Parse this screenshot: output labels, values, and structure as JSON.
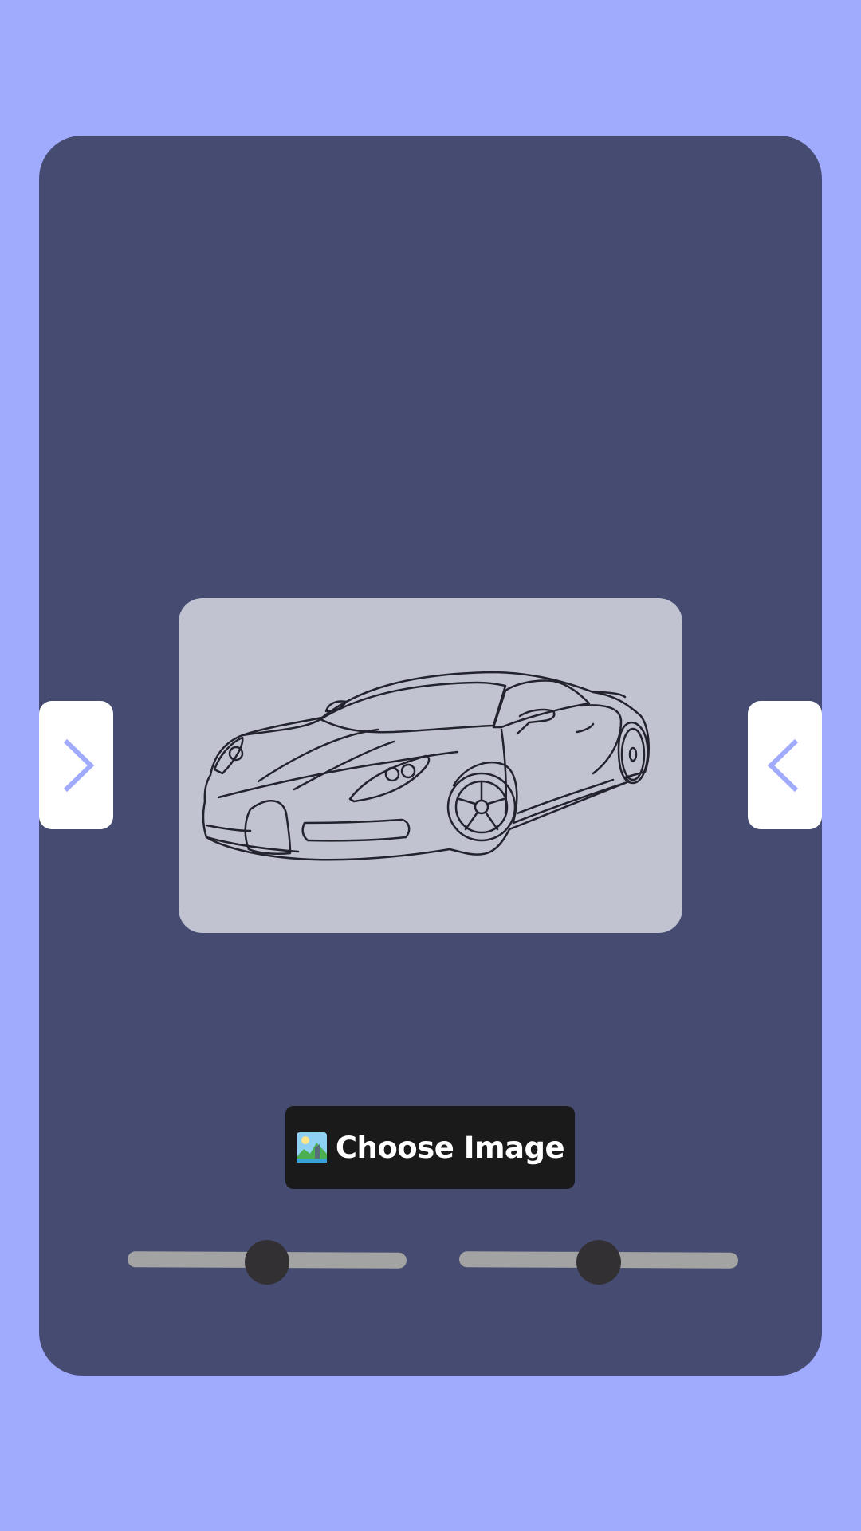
{
  "nav": {
    "left_icon": "chevron-right-icon",
    "right_icon": "chevron-left-icon",
    "icon_color": "#a0abfe"
  },
  "preview": {
    "image": "car-sketch",
    "background": "#c1c3d1"
  },
  "choose_button": {
    "icon": "picture-emoji-icon",
    "label": "Choose Image"
  },
  "sliders": [
    {
      "value": 0.5
    },
    {
      "value": 0.5
    }
  ],
  "colors": {
    "page_bg": "#a0abfe",
    "panel_bg": "#464c71",
    "button_bg": "#1a1a1b",
    "track": "#a3a3a4",
    "thumb": "#333033"
  }
}
